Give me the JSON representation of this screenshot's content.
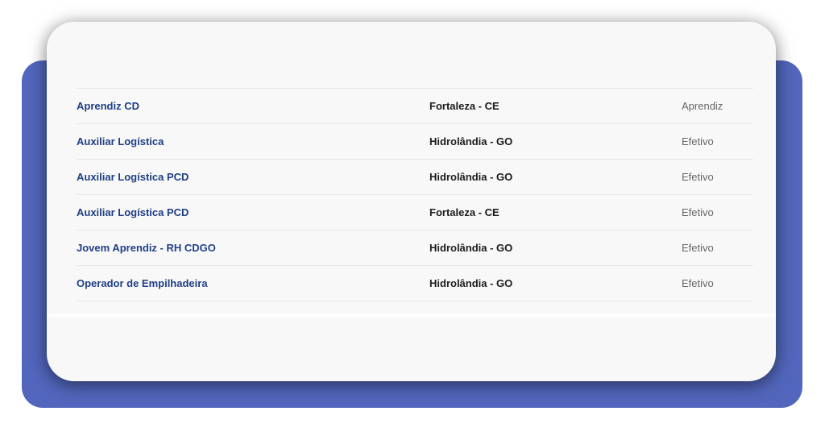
{
  "jobs": [
    {
      "title": "Aprendiz CD",
      "location": "Fortaleza - CE",
      "type": "Aprendiz"
    },
    {
      "title": "Auxiliar Logística",
      "location": "Hidrolândia - GO",
      "type": "Efetivo"
    },
    {
      "title": "Auxiliar Logística PCD",
      "location": "Hidrolândia - GO",
      "type": "Efetivo"
    },
    {
      "title": "Auxiliar Logística PCD",
      "location": "Fortaleza - CE",
      "type": "Efetivo"
    },
    {
      "title": "Jovem Aprendiz - RH CDGO",
      "location": "Hidrolândia - GO",
      "type": "Efetivo"
    },
    {
      "title": "Operador de Empilhadeira",
      "location": "Hidrolândia - GO",
      "type": "Efetivo"
    }
  ],
  "colors": {
    "backdrop": "#5266bd",
    "title_link": "#1f3f85"
  }
}
